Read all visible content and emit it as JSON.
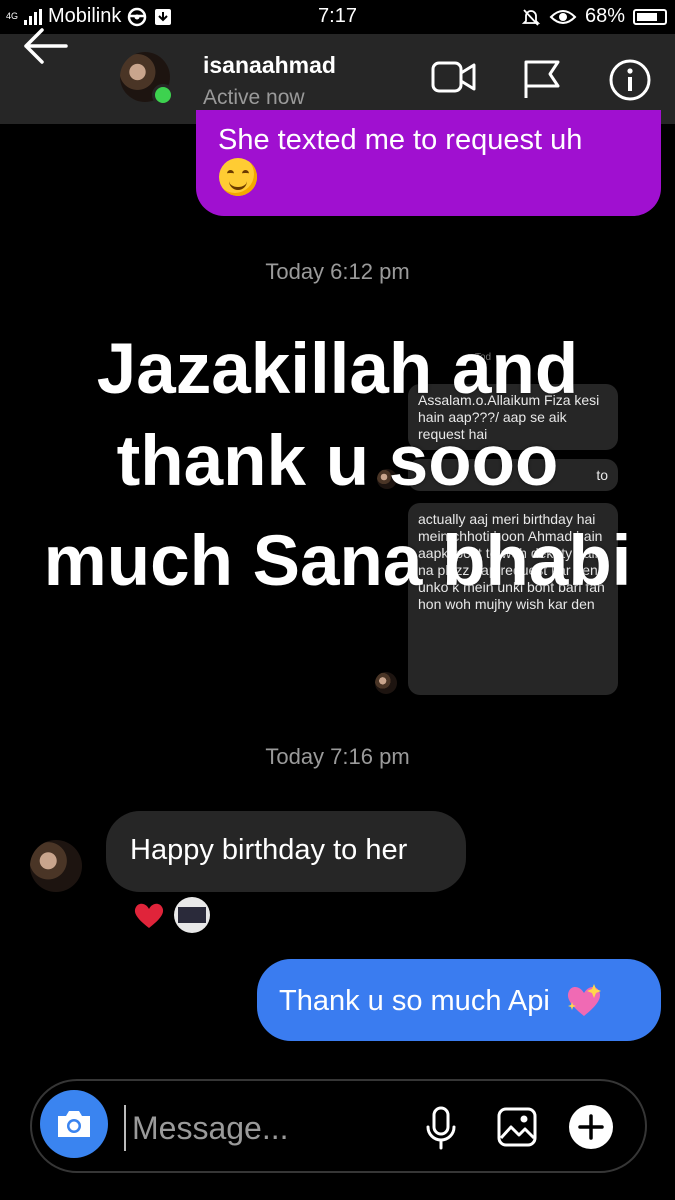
{
  "status_bar": {
    "network_type": "4G",
    "carrier": "Mobilink",
    "time": "7:17",
    "battery": "68%"
  },
  "header": {
    "username": "isanaahmad",
    "status": "Active now",
    "icons": [
      "back-arrow-icon",
      "video-call-icon",
      "flag-icon",
      "info-icon"
    ]
  },
  "messages": {
    "sent_purple": "She texted me to request uh",
    "timestamp_1": "Today 6:12 pm",
    "screenshot_card_1": "Assalam.o.Allaikum Fiza kesi hain aap???/ aap se aik request hai",
    "screenshot_card_2": "to",
    "screenshot_card_3": "actually aaj meri birthday hai mein chhoti hoon Ahmad hain aapki post to woh dekhty hain na plzzz aap request kar den unko k mein unki boht bari fan hon woh mujhy wish kar den",
    "timestamp_2": "Today 7:16 pm",
    "received": "Happy birthday to her",
    "sent_blue": "Thank u so much Api"
  },
  "overlay_text": {
    "line1": "Jazakillah and",
    "line2": "thank u sooo",
    "line3": "much Sana bhabi"
  },
  "composer": {
    "placeholder": "Message..."
  },
  "colors": {
    "header_bg": "#262626",
    "purple_bubble": "#a010d0",
    "blue_bubble": "#3a7cf0",
    "grey_bubble": "#262626",
    "online_dot": "#3dd24f",
    "camera_button": "#3a84f0"
  }
}
